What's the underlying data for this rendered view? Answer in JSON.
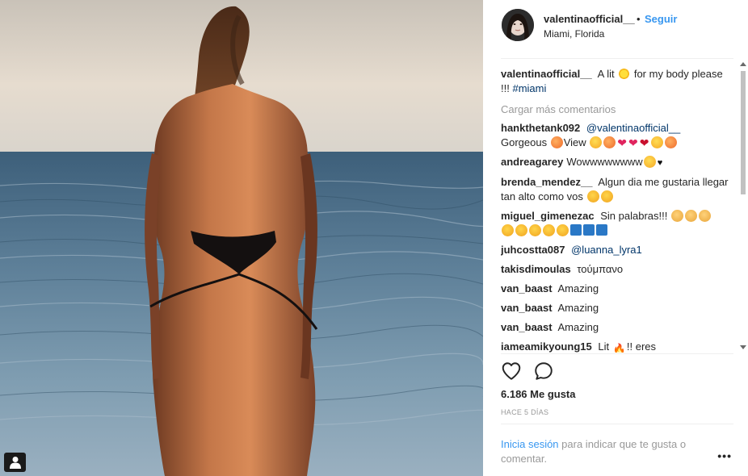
{
  "post": {
    "author": "valentinaofficial__",
    "separator": "•",
    "follow_label": "Seguir",
    "location": "Miami, Florida"
  },
  "caption": {
    "user": "valentinaofficial__",
    "text_before": "A lit",
    "text_after": "for my body please !!!",
    "hashtag": "#miami"
  },
  "load_more": "Cargar más comentarios",
  "comments": [
    {
      "user": "hankthetank092",
      "mention": "@valentinaofficial__",
      "text": "Gorgeous",
      "text2": "View"
    },
    {
      "user": "andreagarey",
      "text": "Wowwwwwwww"
    },
    {
      "user": "brenda_mendez__",
      "text": "Algun dia me gustaria llegar tan alto como vos"
    },
    {
      "user": "miguel_gimenezac",
      "text": "Sin palabras!!!"
    },
    {
      "user": "juhcostta087",
      "mention": "@luanna_lyra1"
    },
    {
      "user": "takisdimoulas",
      "text": "τούμπανο"
    },
    {
      "user": "van_baast",
      "text": "Amazing"
    },
    {
      "user": "van_baast",
      "text": "Amazing"
    },
    {
      "user": "van_baast",
      "text": "Amazing"
    },
    {
      "user": "iameamikyoung15",
      "text_before": "Lit",
      "text_after": "!! eres"
    }
  ],
  "likes_text": "6.186 Me gusta",
  "time_text": "HACE 5 DÍAS",
  "login": {
    "link": "Inicia sesión",
    "rest": "para indicar que te gusta o comentar."
  },
  "more_options": "•••",
  "icons": {
    "like": "heart-outline-icon",
    "comment": "speech-bubble-icon",
    "profile": "user-silhouette-icon"
  },
  "colors": {
    "link_blue": "#3897f0",
    "mention_blue": "#003569",
    "muted": "#999999",
    "text": "#262626"
  }
}
